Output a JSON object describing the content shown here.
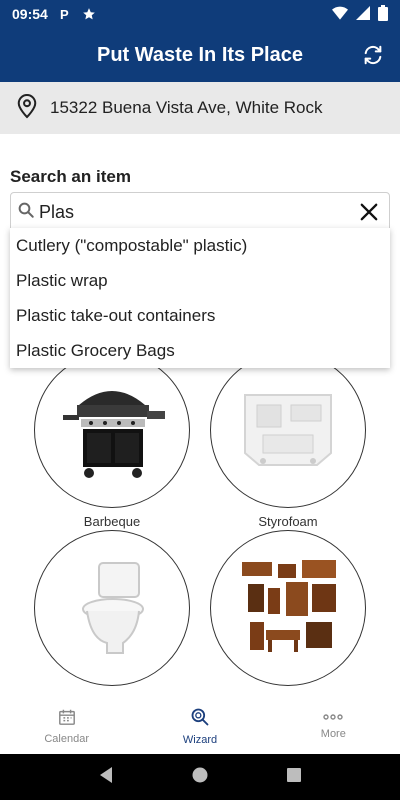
{
  "status_bar": {
    "time": "09:54"
  },
  "header": {
    "title": "Put Waste In Its Place"
  },
  "address": {
    "text": "15322 Buena Vista Ave, White Rock"
  },
  "search": {
    "label": "Search an item",
    "value": "Plas",
    "suggestions": [
      "Cutlery (\"compostable\" plastic)",
      "Plastic wrap",
      "Plastic take-out containers",
      "Plastic Grocery Bags"
    ]
  },
  "items": [
    {
      "label": "Barbeque",
      "icon": "barbeque-image"
    },
    {
      "label": "Styrofoam",
      "icon": "styrofoam-image"
    },
    {
      "label": "",
      "icon": "toilet-image"
    },
    {
      "label": "",
      "icon": "furniture-image"
    }
  ],
  "nav": {
    "items": [
      {
        "label": "Calendar",
        "icon": "calendar-icon"
      },
      {
        "label": "Wizard",
        "icon": "wizard-search-icon"
      },
      {
        "label": "More",
        "icon": "more-dots-icon"
      }
    ],
    "active": "Wizard"
  },
  "colors": {
    "header": "#0f3c7a",
    "nav_active": "#1c3f7d",
    "nav_inactive": "#888888"
  }
}
